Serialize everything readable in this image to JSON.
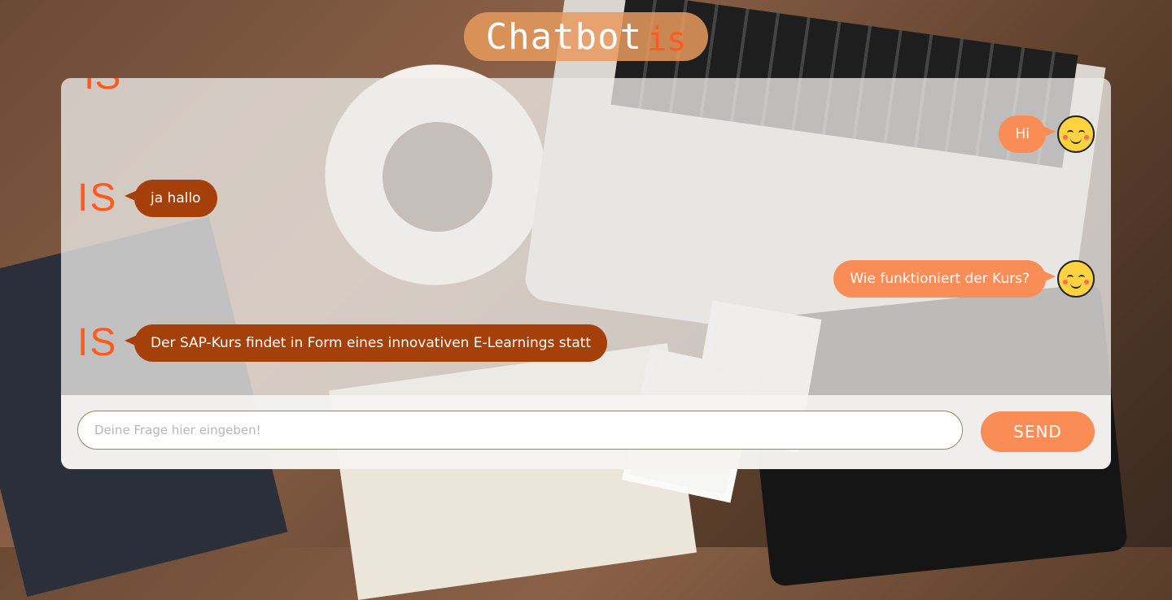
{
  "header": {
    "title_main": "Chatbot",
    "title_accent": "is"
  },
  "chat": {
    "bot_logo_text": "IS",
    "messages": [
      {
        "sender": "user",
        "text": "Hi"
      },
      {
        "sender": "bot",
        "text": "ja hallo"
      },
      {
        "sender": "user",
        "text": "Wie funktioniert der Kurs?"
      },
      {
        "sender": "bot",
        "text": "Der SAP-Kurs findet in Form eines innovativen E-Learnings statt"
      }
    ]
  },
  "input": {
    "placeholder": "Deine Frage hier eingeben!",
    "value": ""
  },
  "send_button": {
    "label": "SEND"
  },
  "colors": {
    "accent": "#f98d55",
    "bot_bubble": "#a5400a",
    "logo": "#ff5a1f",
    "title_pill": "#e89a5e"
  },
  "icons": {
    "user_avatar": "smiley-icon",
    "bot_avatar": "is-logo"
  }
}
